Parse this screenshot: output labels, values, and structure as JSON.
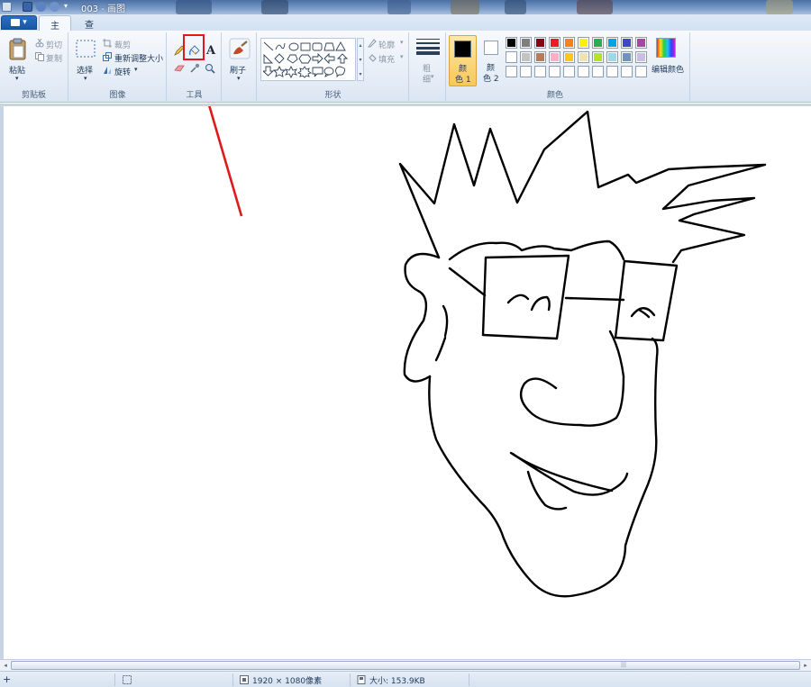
{
  "window": {
    "title": "003 - 画图"
  },
  "tabs": {
    "app_menu_label": "▾",
    "home": "主页",
    "view": "查看"
  },
  "clipboard": {
    "paste": "粘贴",
    "cut": "剪切",
    "copy": "复制",
    "group": "剪贴板"
  },
  "image": {
    "select": "选择",
    "crop": "裁剪",
    "resize": "重新调整大小",
    "rotate": "旋转",
    "group": "图像"
  },
  "tools": {
    "group": "工具",
    "text_glyph": "A"
  },
  "brushes": {
    "label": "刷子"
  },
  "shapes": {
    "outline": "轮廓",
    "fill": "填充",
    "group": "形状"
  },
  "size": {
    "label_1": "粗",
    "label_2": "细"
  },
  "colors": {
    "color1_a": "颜",
    "color1_b": "色 1",
    "color2_a": "颜",
    "color2_b": "色 2",
    "edit": "编辑颜色",
    "group": "颜色",
    "color1_value": "#000000",
    "color2_value": "#ffffff",
    "palette_row1": [
      "#000000",
      "#7f7f7f",
      "#880015",
      "#ed1c24",
      "#ff7f27",
      "#fff200",
      "#22b14c",
      "#00a2e8",
      "#3f48cc",
      "#a349a4"
    ],
    "palette_row2": [
      "#ffffff",
      "#c3c3c3",
      "#b97a57",
      "#ffaec9",
      "#ffc90e",
      "#efe4b0",
      "#b5e61d",
      "#99d9ea",
      "#7092be",
      "#c8bfe7"
    ],
    "palette_row3": [
      "#ffffff",
      "#ffffff",
      "#ffffff",
      "#ffffff",
      "#ffffff",
      "#ffffff",
      "#ffffff",
      "#ffffff",
      "#ffffff",
      "#ffffff"
    ]
  },
  "status": {
    "dimensions": "1920 × 1080像素",
    "size": "大小: 153.9KB"
  },
  "annotation": {
    "highlight_color": "#e0191b",
    "arrow_color": "#e0191b"
  }
}
